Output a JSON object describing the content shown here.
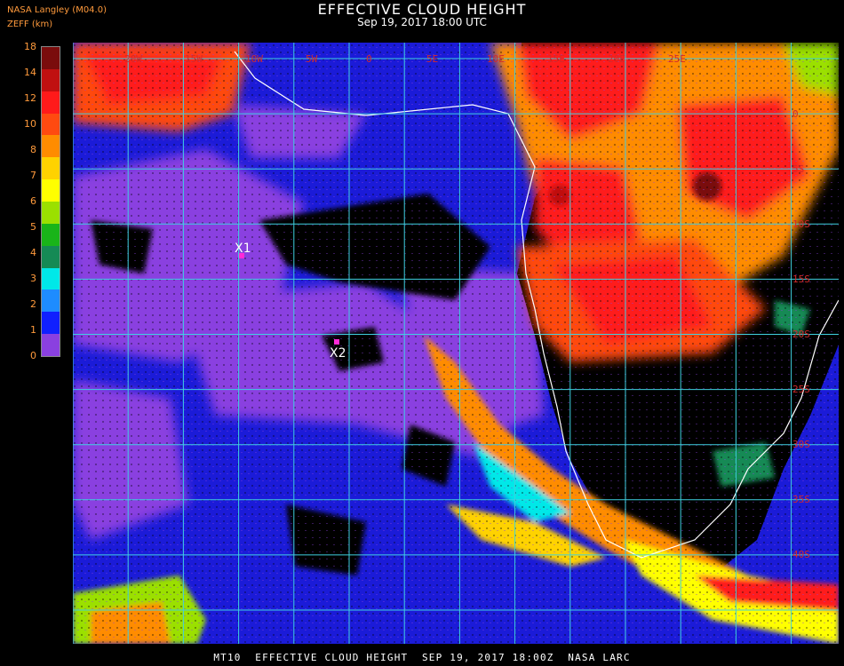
{
  "title": "EFFECTIVE CLOUD HEIGHT",
  "subtitle": "Sep 19, 2017 18:00 UTC",
  "source": "NASA Langley (M04.0)",
  "units": "ZEFF (km)",
  "footer": "MT10  EFFECTIVE CLOUD HEIGHT  SEP 19, 2017 18:00Z  NASA LARC",
  "legend": {
    "ticks": [
      "18",
      "14",
      "12",
      "10",
      "8",
      "7",
      "6",
      "5",
      "4",
      "3",
      "2",
      "1",
      "0"
    ],
    "colors": [
      "#7a0c0c",
      "#c01010",
      "#ff1a1a",
      "#ff4a10",
      "#ff8c00",
      "#ffd200",
      "#ffff00",
      "#9be000",
      "#19b419",
      "#158a55",
      "#00e8e8",
      "#1e8cff",
      "#1020ff",
      "#8a40e0"
    ]
  },
  "map": {
    "lon_labels": [
      "20W",
      "15W",
      "10W",
      "5W",
      "0",
      "5E",
      "10E",
      "15E",
      "20E",
      "25E"
    ],
    "lat_labels": [
      "0",
      "5S",
      "10S",
      "15S",
      "20S",
      "25S",
      "30S",
      "35S",
      "40S"
    ],
    "markers": [
      {
        "id": "X1",
        "label": "X1",
        "color": "#ff2ad8"
      },
      {
        "id": "X2",
        "label": "X2",
        "color": "#ff2ad8"
      }
    ]
  }
}
